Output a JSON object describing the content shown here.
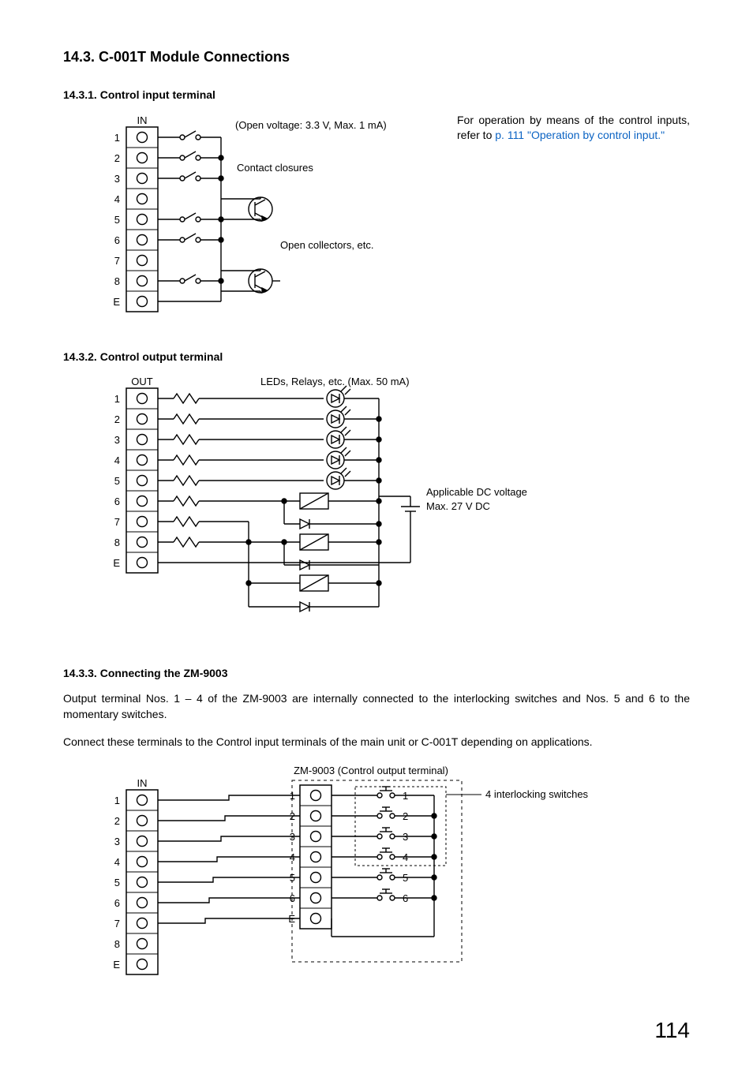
{
  "section": {
    "title": "14.3. C-001T Module Connections",
    "sub1": {
      "heading": "14.3.1. Control input terminal",
      "in_label": "IN",
      "open_voltage": "(Open voltage: 3.3 V, Max. 1 mA)",
      "contact_closures": "Contact closures",
      "open_collectors": "Open collectors, etc.",
      "terminals": [
        "1",
        "2",
        "3",
        "4",
        "5",
        "6",
        "7",
        "8",
        "E"
      ],
      "side_text_pre": "For operation by means of the control inputs, refer to ",
      "side_link_text": "p. 111 \"Operation by control input.\""
    },
    "sub2": {
      "heading": "14.3.2. Control output terminal",
      "out_label": "OUT",
      "leds_relays": "LEDs, Relays, etc. (Max. 50 mA)",
      "dc_voltage1": "Applicable DC voltage",
      "dc_voltage2": "Max. 27 V DC",
      "terminals": [
        "1",
        "2",
        "3",
        "4",
        "5",
        "6",
        "7",
        "8",
        "E"
      ]
    },
    "sub3": {
      "heading": "14.3.3. Connecting the ZM-9003",
      "para1": "Output terminal Nos. 1 – 4 of the ZM-9003 are internally connected to the interlocking switches and Nos. 5 and 6 to the momentary switches.",
      "para2": "Connect these terminals to the Control input terminals of the main unit or C-001T depending on applications.",
      "zm_caption": "ZM-9003 (Control output terminal)",
      "in_label": "IN",
      "interlock_label": "4 interlocking switches",
      "left_terminals": [
        "1",
        "2",
        "3",
        "4",
        "5",
        "6",
        "7",
        "8",
        "E"
      ],
      "right_terminals": [
        "1",
        "2",
        "3",
        "4",
        "5",
        "6",
        "E"
      ],
      "switch_labels": [
        "1",
        "2",
        "3",
        "4",
        "5",
        "6"
      ]
    }
  },
  "page_number": "114"
}
